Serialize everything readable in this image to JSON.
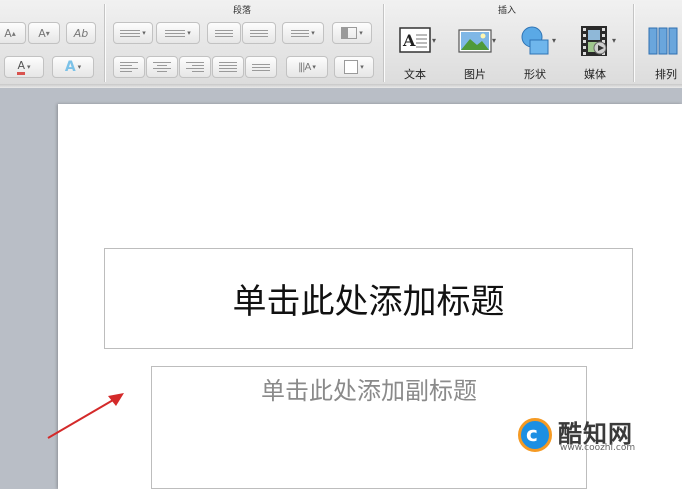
{
  "ribbon": {
    "group_paragraph": "段落",
    "group_insert": "插入",
    "font": {
      "grow_label": "A",
      "shrink_label": "A",
      "clear_label": "Ab",
      "color_label": "A",
      "effect_label": "A"
    },
    "insert": {
      "text_label": "文本",
      "picture_label": "图片",
      "shape_label": "形状",
      "media_label": "媒体",
      "arrange_label": "排列"
    }
  },
  "slide": {
    "title_placeholder": "单击此处添加标题",
    "subtitle_placeholder": "单击此处添加副标题"
  },
  "watermark": {
    "logo_letter": "c",
    "name": "酷知网",
    "url": "www.coozhi.com"
  }
}
